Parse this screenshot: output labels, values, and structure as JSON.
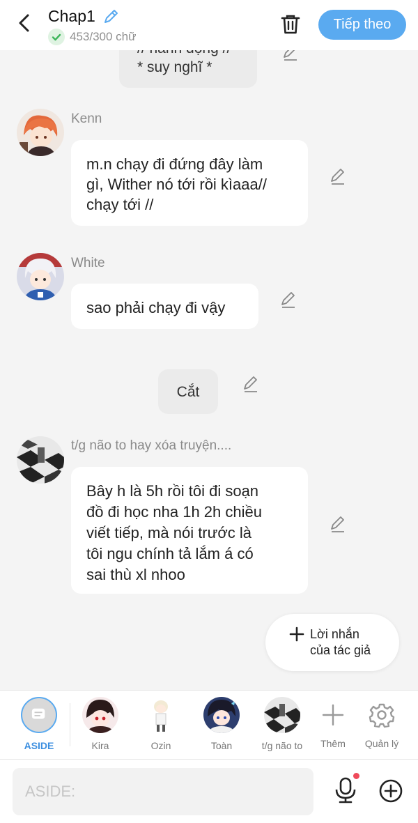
{
  "header": {
    "title": "Chap1",
    "word_count": "453/300 chữ",
    "next_label": "Tiếp theo"
  },
  "messages": {
    "top_fragment_line1": "// hành động //",
    "top_fragment_line2": "* suy nghĩ *",
    "kenn": {
      "name": "Kenn",
      "text_line1": "m.n chạy đi đứng đây làm",
      "text_line2": "gì, Wither nó tới rồi kìaaa//",
      "text_line3": "chạy tới //"
    },
    "white": {
      "name": "White",
      "text": "sao phải chạy đi vậy"
    },
    "cut": "Cắt",
    "author": {
      "name": "t/g não to hay xóa truyện....",
      "text_line1": "Bây h là 5h rồi tôi đi soạn",
      "text_line2": "đồ đi học nha 1h 2h chiều",
      "text_line3": "viết tiếp, mà nói trước là",
      "text_line4": "tôi ngu chính tả lắm á có",
      "text_line5": "sai thù xl nhoo"
    }
  },
  "author_note": {
    "line1": "Lời nhắn",
    "line2": "của tác giả"
  },
  "characters": [
    {
      "label": "ASIDE"
    },
    {
      "label": "Kira"
    },
    {
      "label": "Ozin"
    },
    {
      "label": "Toàn"
    },
    {
      "label": "t/g não to"
    },
    {
      "label": "Thêm"
    },
    {
      "label": "Quản lý"
    }
  ],
  "input": {
    "placeholder": "ASIDE:"
  },
  "colors": {
    "accent": "#5aaaf0",
    "background": "#f4f4f4",
    "success": "#3cb55a",
    "notification": "#ef4a5a"
  }
}
